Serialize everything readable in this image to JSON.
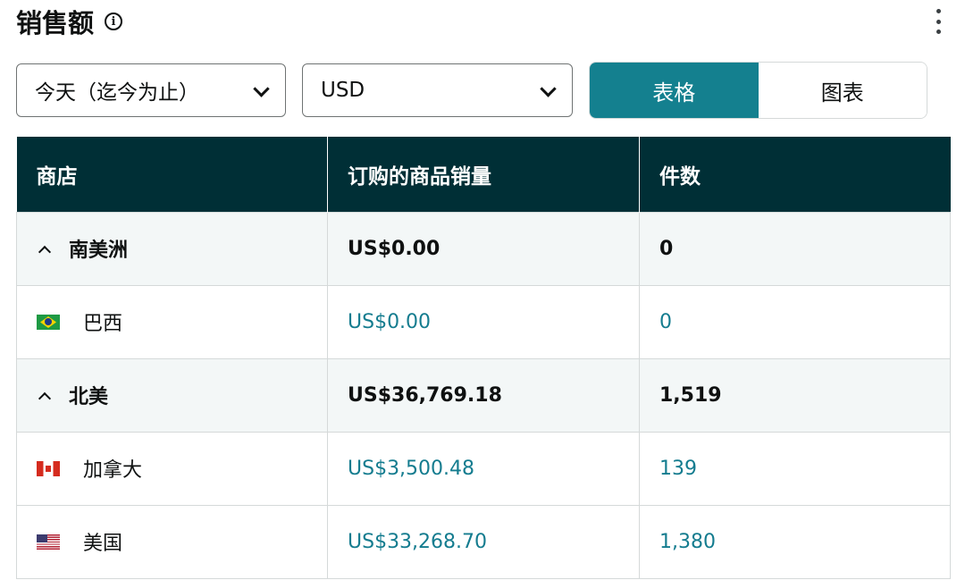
{
  "header": {
    "title": "销售额",
    "info_icon": "info-icon",
    "menu_icon": "kebab-icon"
  },
  "filters": {
    "date_range": "今天（迄今为止）",
    "currency": "USD"
  },
  "view_toggle": {
    "table_label": "表格",
    "chart_label": "图表",
    "active": "table"
  },
  "table": {
    "columns": [
      "商店",
      "订购的商品销量",
      "件数"
    ],
    "rows": [
      {
        "type": "group",
        "name": "南美洲",
        "sales": "US$0.00",
        "units": "0"
      },
      {
        "type": "child",
        "flag": "brazil-flag-icon",
        "name": "巴西",
        "sales": "US$0.00",
        "units": "0"
      },
      {
        "type": "group",
        "name": "北美",
        "sales": "US$36,769.18",
        "units": "1,519"
      },
      {
        "type": "child",
        "flag": "canada-flag-icon",
        "name": "加拿大",
        "sales": "US$3,500.48",
        "units": "139"
      },
      {
        "type": "child",
        "flag": "usa-flag-icon",
        "name": "美国",
        "sales": "US$33,268.70",
        "units": "1,380"
      }
    ]
  },
  "colors": {
    "header_bg": "#002f36",
    "accent": "#14808f",
    "link": "#147c8f",
    "group_bg": "#f3f7f7"
  }
}
